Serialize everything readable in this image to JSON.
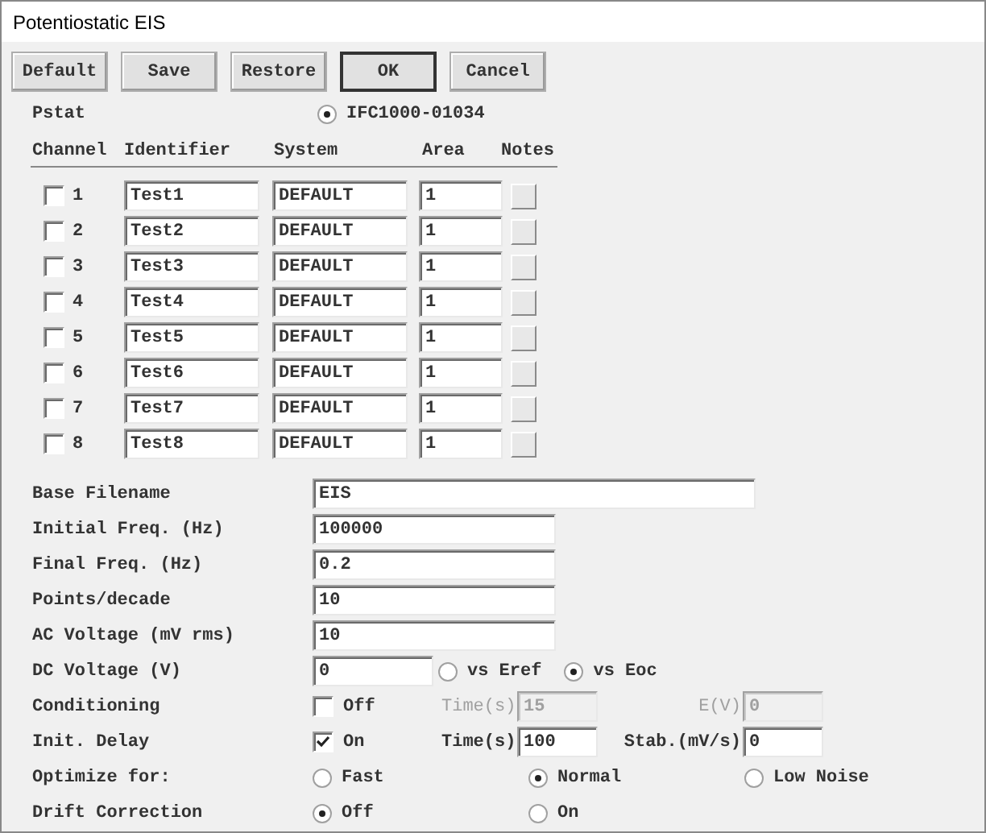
{
  "window": {
    "title": "Potentiostatic EIS"
  },
  "buttons": [
    {
      "label": "Default",
      "default": false
    },
    {
      "label": "Save",
      "default": false
    },
    {
      "label": "Restore",
      "default": false
    },
    {
      "label": "OK",
      "default": true
    },
    {
      "label": "Cancel",
      "default": false
    }
  ],
  "pstat": {
    "label": "Pstat",
    "options": [
      {
        "label": "IFC1000-01034",
        "selected": true
      }
    ]
  },
  "channels": {
    "columns": [
      "Channel",
      "Identifier",
      "System",
      "Area",
      "Notes"
    ],
    "rows": [
      {
        "checked": false,
        "number": "1",
        "identifier": "Test1",
        "system": "DEFAULT",
        "area": "1"
      },
      {
        "checked": false,
        "number": "2",
        "identifier": "Test2",
        "system": "DEFAULT",
        "area": "1"
      },
      {
        "checked": false,
        "number": "3",
        "identifier": "Test3",
        "system": "DEFAULT",
        "area": "1"
      },
      {
        "checked": false,
        "number": "4",
        "identifier": "Test4",
        "system": "DEFAULT",
        "area": "1"
      },
      {
        "checked": false,
        "number": "5",
        "identifier": "Test5",
        "system": "DEFAULT",
        "area": "1"
      },
      {
        "checked": false,
        "number": "6",
        "identifier": "Test6",
        "system": "DEFAULT",
        "area": "1"
      },
      {
        "checked": false,
        "number": "7",
        "identifier": "Test7",
        "system": "DEFAULT",
        "area": "1"
      },
      {
        "checked": false,
        "number": "8",
        "identifier": "Test8",
        "system": "DEFAULT",
        "area": "1"
      }
    ]
  },
  "params": [
    {
      "kind": "long-field",
      "label": "Base Filename",
      "value": "EIS"
    },
    {
      "kind": "field",
      "label": "Initial Freq. (Hz)",
      "value": "100000"
    },
    {
      "kind": "field",
      "label": "Final Freq. (Hz)",
      "value": "0.2"
    },
    {
      "kind": "field",
      "label": "Points/decade",
      "value": "10"
    },
    {
      "kind": "field",
      "label": "AC Voltage (mV rms)",
      "value": "10"
    },
    {
      "kind": "field-radios",
      "label": "DC Voltage (V)",
      "value": "0",
      "options": [
        {
          "label": "vs Eref",
          "selected": false
        },
        {
          "label": "vs Eoc",
          "selected": true
        }
      ]
    },
    {
      "kind": "check-fields",
      "label": "Conditioning",
      "check_label": "Off",
      "checked": false,
      "disabled": true,
      "fields": [
        {
          "label": "Time(s)",
          "value": "15"
        },
        {
          "label": "E(V)",
          "value": "0"
        }
      ]
    },
    {
      "kind": "check-fields",
      "label": "Init. Delay",
      "check_label": "On",
      "checked": true,
      "disabled": false,
      "fields": [
        {
          "label": "Time(s)",
          "value": "100"
        },
        {
          "label": "Stab.(mV/s)",
          "value": "0"
        }
      ]
    },
    {
      "kind": "radios",
      "label": "Optimize for:",
      "options": [
        {
          "label": "Fast",
          "selected": false
        },
        {
          "label": "Normal",
          "selected": true
        },
        {
          "label": "Low Noise",
          "selected": false
        }
      ]
    },
    {
      "kind": "radios",
      "label": "Drift Correction",
      "options": [
        {
          "label": "Off",
          "selected": true
        },
        {
          "label": "On",
          "selected": false
        }
      ]
    }
  ]
}
